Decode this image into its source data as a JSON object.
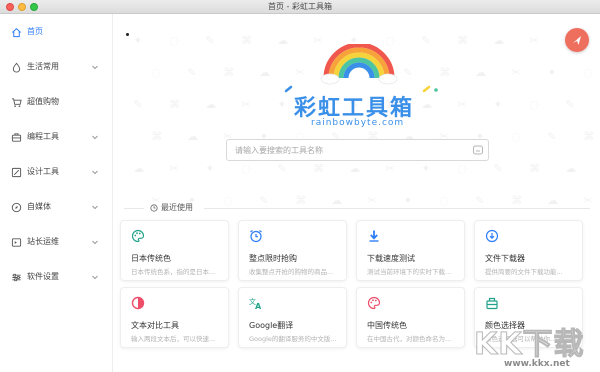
{
  "window": {
    "title": "首页 - 彩虹工具箱"
  },
  "sidebar": {
    "items": [
      {
        "label": "首页",
        "icon": "home-icon",
        "active": true,
        "expandable": false
      },
      {
        "label": "生活常用",
        "icon": "droplet-icon",
        "active": false,
        "expandable": true
      },
      {
        "label": "超值购物",
        "icon": "cart-icon",
        "active": false,
        "expandable": false
      },
      {
        "label": "编程工具",
        "icon": "briefcase-icon",
        "active": false,
        "expandable": true
      },
      {
        "label": "设计工具",
        "icon": "design-icon",
        "active": false,
        "expandable": true
      },
      {
        "label": "自媒体",
        "icon": "compass-icon",
        "active": false,
        "expandable": true
      },
      {
        "label": "站长运维",
        "icon": "server-icon",
        "active": false,
        "expandable": true
      },
      {
        "label": "软件设置",
        "icon": "sliders-icon",
        "active": false,
        "expandable": true
      }
    ]
  },
  "logo": {
    "title": "彩虹工具箱",
    "subtitle": "rainbowbyte.com"
  },
  "search": {
    "placeholder": "请输入要搜索的工具名称"
  },
  "recent": {
    "label": "最近使用"
  },
  "cards": [
    {
      "title": "日本传统色",
      "desc": "日本传统色系，指的是日本...",
      "icon": "palette-icon",
      "color": "#22a389"
    },
    {
      "title": "整点限时抢购",
      "desc": "收集整点开抢的购物的商品...",
      "icon": "alarm-clock-icon",
      "color": "#2f7df6"
    },
    {
      "title": "下载速度测试",
      "desc": "测试当前环境下的实时下载...",
      "icon": "download-arrow-icon",
      "color": "#2f7df6"
    },
    {
      "title": "文件下载器",
      "desc": "提供简要的文件下载功能...",
      "icon": "download-circle-icon",
      "color": "#2f7df6"
    },
    {
      "title": "文本对比工具",
      "desc": "输入两段文本后，可以快速...",
      "icon": "contrast-icon",
      "color": "#ee4d6a"
    },
    {
      "title": "Google翻译",
      "desc": "Google的翻译服务的中文版...",
      "icon": "translate-icon",
      "color": "#22a389"
    },
    {
      "title": "中国传统色",
      "desc": "在中国古代，对颜色命名为...",
      "icon": "palette-icon",
      "color": "#ee4d6a"
    },
    {
      "title": "颜色选择器",
      "desc": "颜色选择器可以帮助你...",
      "icon": "color-box-icon",
      "color": "#22a389"
    }
  ],
  "watermark": {
    "brand": "KK下载",
    "url": "www.kkx.net"
  },
  "colors": {
    "accent": "#2f7df6",
    "fab": "#ef6f5f",
    "logo": "#3a8fe8"
  }
}
